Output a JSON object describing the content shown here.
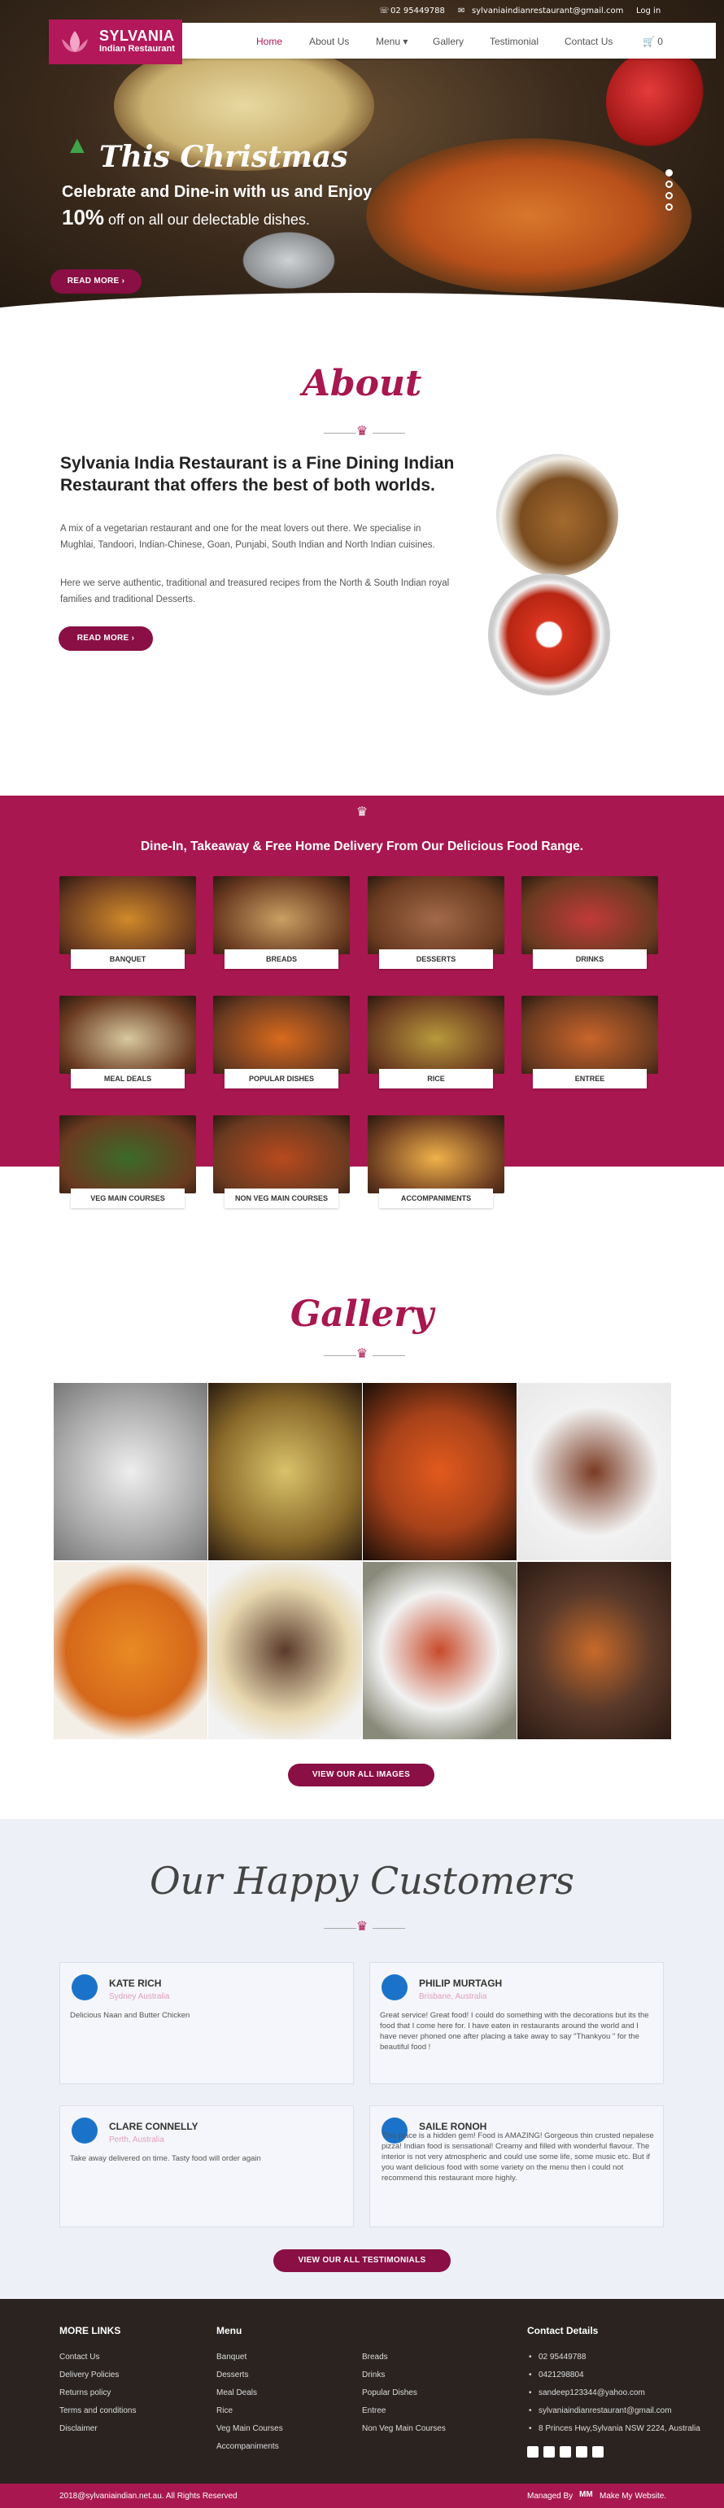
{
  "topbar": {
    "phone": "02 95449788",
    "email": "sylvaniaindianrestaurant@gmail.com",
    "login": "Log in"
  },
  "logo": {
    "name": "SYLVANIA",
    "sub": "Indian Restaurant",
    "tag": "Indian Restaurant"
  },
  "nav": [
    "Home",
    "About Us",
    "Menu ▾",
    "Gallery",
    "Testimonial",
    "Contact Us"
  ],
  "cart": "0",
  "hero": {
    "title": "This Christmas",
    "line1": "Celebrate and Dine-in with us and Enjoy",
    "line2_bold": "10%",
    "line2_rest": " off on all our delectable dishes.",
    "button": "READ MORE"
  },
  "about": {
    "title": "About",
    "heading": "Sylvania India Restaurant is a Fine Dining Indian Restaurant that offers the best of both worlds.",
    "p1": "A mix of a vegetarian restaurant and one for the meat lovers out there. We specialise in Mughlai, Tandoori, Indian-Chinese, Goan, Punjabi, South Indian and North Indian cuisines.",
    "p2": "Here we serve authentic, traditional and treasured recipes from the North & South Indian royal families and traditional Desserts.",
    "button": "READ MORE"
  },
  "categories": {
    "heading": "Dine-In, Takeaway & Free Home Delivery From Our Delicious Food Range.",
    "items": [
      "BANQUET",
      "BREADS",
      "DESSERTS",
      "DRINKS",
      "MEAL DEALS",
      "POPULAR DISHES",
      "RICE",
      "ENTREE",
      "VEG MAIN COURSES",
      "NON VEG MAIN COURSES",
      "ACCOMPANIMENTS"
    ]
  },
  "gallery": {
    "title": "Gallery",
    "button": "VIEW OUR ALL IMAGES"
  },
  "testimonials": {
    "title": "Our Happy Customers",
    "items": [
      {
        "name": "KATE RICH",
        "loc": "Sydney Australia",
        "text": "Delicious Naan and Butter Chicken"
      },
      {
        "name": "PHILIP MURTAGH",
        "loc": "Brisbane, Australia",
        "text": "Great service! Great food! I could do something with the decorations but its the food that I come here for. I have eaten in restaurants around the world and I have never phoned one after placing a take away to say \"Thankyou \" for the beautiful food !"
      },
      {
        "name": "CLARE CONNELLY",
        "loc": "Perth, Australia",
        "text": "Take away delivered on time. Tasty food will order again"
      },
      {
        "name": "SAILE RONOH",
        "loc": "",
        "text": "This place is a hidden gem! Food is AMAZING! Gorgeous thin crusted nepalese pizza! Indian food is sensational! Creamy and filled with wonderful flavour. The interior is not very atmospheric and could use some life, some music etc. But if you want delicious food with some variety on the menu then i could not recommend this restaurant more highly."
      }
    ],
    "button": "VIEW OUR ALL TESTIMONIALS"
  },
  "footer": {
    "more_title": "MORE LINKS",
    "more": [
      "Contact Us",
      "Delivery Policies",
      "Returns policy",
      "Terms and conditions",
      "Disclaimer"
    ],
    "menu_title": "Menu",
    "menu1": [
      "Banquet",
      "Desserts",
      "Meal Deals",
      "Rice",
      "Veg Main Courses",
      "Accompaniments"
    ],
    "menu2": [
      "Breads",
      "Drinks",
      "Popular Dishes",
      "Entree",
      "Non Veg Main Courses"
    ],
    "contact_title": "Contact Details",
    "contact": [
      "02 95449788",
      "0421298804",
      "sandeep123344@yahoo.com",
      "sylvaniaindianrestaurant@gmail.com",
      "8 Princes Hwy,Sylvania NSW 2224, Australia"
    ],
    "copyright": "2018@sylvaniaindian.net.au. All Rights Reserved",
    "managed": "Managed By",
    "managed_by": "Make My Website."
  },
  "colors": {
    "brand": "#a8174f",
    "dark": "#8a0f45",
    "footer": "#2a2320"
  }
}
